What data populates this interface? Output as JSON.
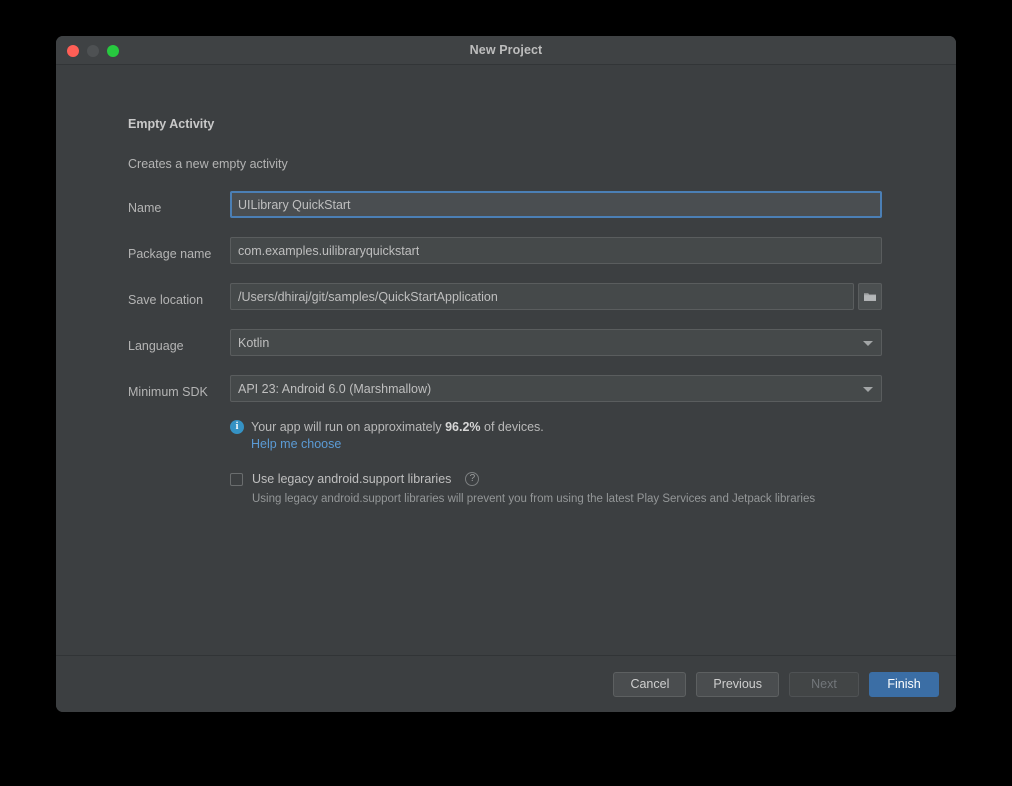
{
  "window": {
    "title": "New Project",
    "traffic_lights": [
      "close-button",
      "minimize-button",
      "maximize-button"
    ]
  },
  "content": {
    "heading": "Empty Activity",
    "subheading": "Creates a new empty activity"
  },
  "form": {
    "rows": [
      {
        "label": "Name",
        "value": "UILibrary QuickStart",
        "type": "text",
        "focused": true
      },
      {
        "label": "Package name",
        "value": "com.examples.uilibraryquickstart",
        "type": "text",
        "focused": false
      },
      {
        "label": "Save location",
        "value": "/Users/dhiraj/git/samples/QuickStartApplication",
        "type": "path",
        "focused": false
      },
      {
        "label": "Language",
        "value": "Kotlin",
        "type": "select",
        "focused": false
      },
      {
        "label": "Minimum SDK",
        "value": "API 23: Android 6.0 (Marshmallow)",
        "type": "select",
        "focused": false
      }
    ]
  },
  "info": {
    "icon": "info-icon",
    "text_before": "Your app will run on approximately ",
    "percentage": "96.2%",
    "text_after": " of devices.",
    "link": "Help me choose"
  },
  "legacy": {
    "checked": false,
    "label": "Use legacy android.support libraries",
    "help_icon": "question-mark-icon",
    "description": "Using legacy android.support libraries will prevent you from using the latest Play Services and Jetpack libraries"
  },
  "footer": {
    "buttons": [
      {
        "label": "Cancel",
        "style": "default",
        "disabled": false
      },
      {
        "label": "Previous",
        "style": "default",
        "disabled": false
      },
      {
        "label": "Next",
        "style": "default",
        "disabled": true
      },
      {
        "label": "Finish",
        "style": "primary",
        "disabled": false
      }
    ]
  },
  "colors": {
    "window_bg": "#3c3f41",
    "titlebar_bg": "#3f4244",
    "field_bg": "#45494a",
    "focus_border": "#4b7fb5",
    "accent_blue": "#3b6ea5",
    "link_blue": "#5b9bd5",
    "info_blue": "#3592c4"
  }
}
